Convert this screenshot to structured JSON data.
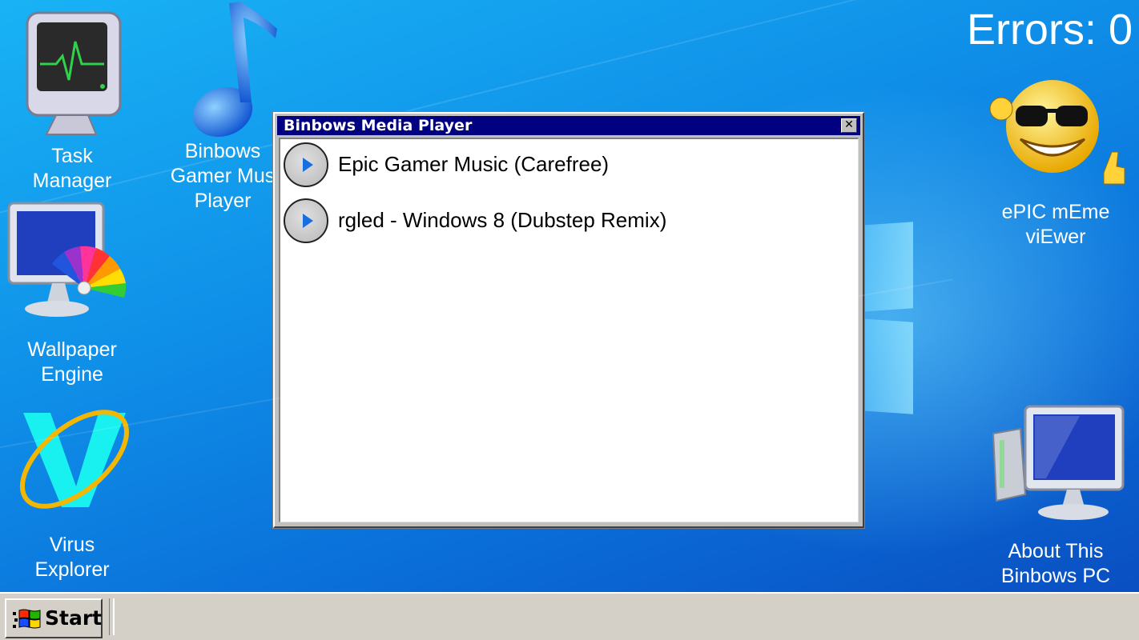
{
  "desktop": {
    "errors_label": "Errors: 0",
    "icons": [
      {
        "label": "Task\nManager",
        "icon": "monitor-heartbeat-icon"
      },
      {
        "label": "Binbows\nGamer Mus\nPlayer",
        "icon": "music-note-icon"
      },
      {
        "label": "Wallpaper\nEngine",
        "icon": "monitor-palette-icon"
      },
      {
        "label": "Virus\nExplorer",
        "icon": "browser-v-icon"
      },
      {
        "label": "ePIC mEme\nviEwer",
        "icon": "cool-smiley-icon"
      },
      {
        "label": "About This\nBinbows PC",
        "icon": "computer-icon"
      }
    ]
  },
  "media_player": {
    "title": "Binbows Media Player",
    "close_glyph": "✕",
    "tracks": [
      {
        "title": "Epic Gamer Music (Carefree)"
      },
      {
        "title": "rgled - Windows 8 (Dubstep Remix)"
      }
    ]
  },
  "taskbar": {
    "start_label": "Start"
  },
  "colors": {
    "titlebar": "#000080",
    "desktop_blue": "#0f8fe8",
    "taskbar": "#d4d0c8"
  }
}
